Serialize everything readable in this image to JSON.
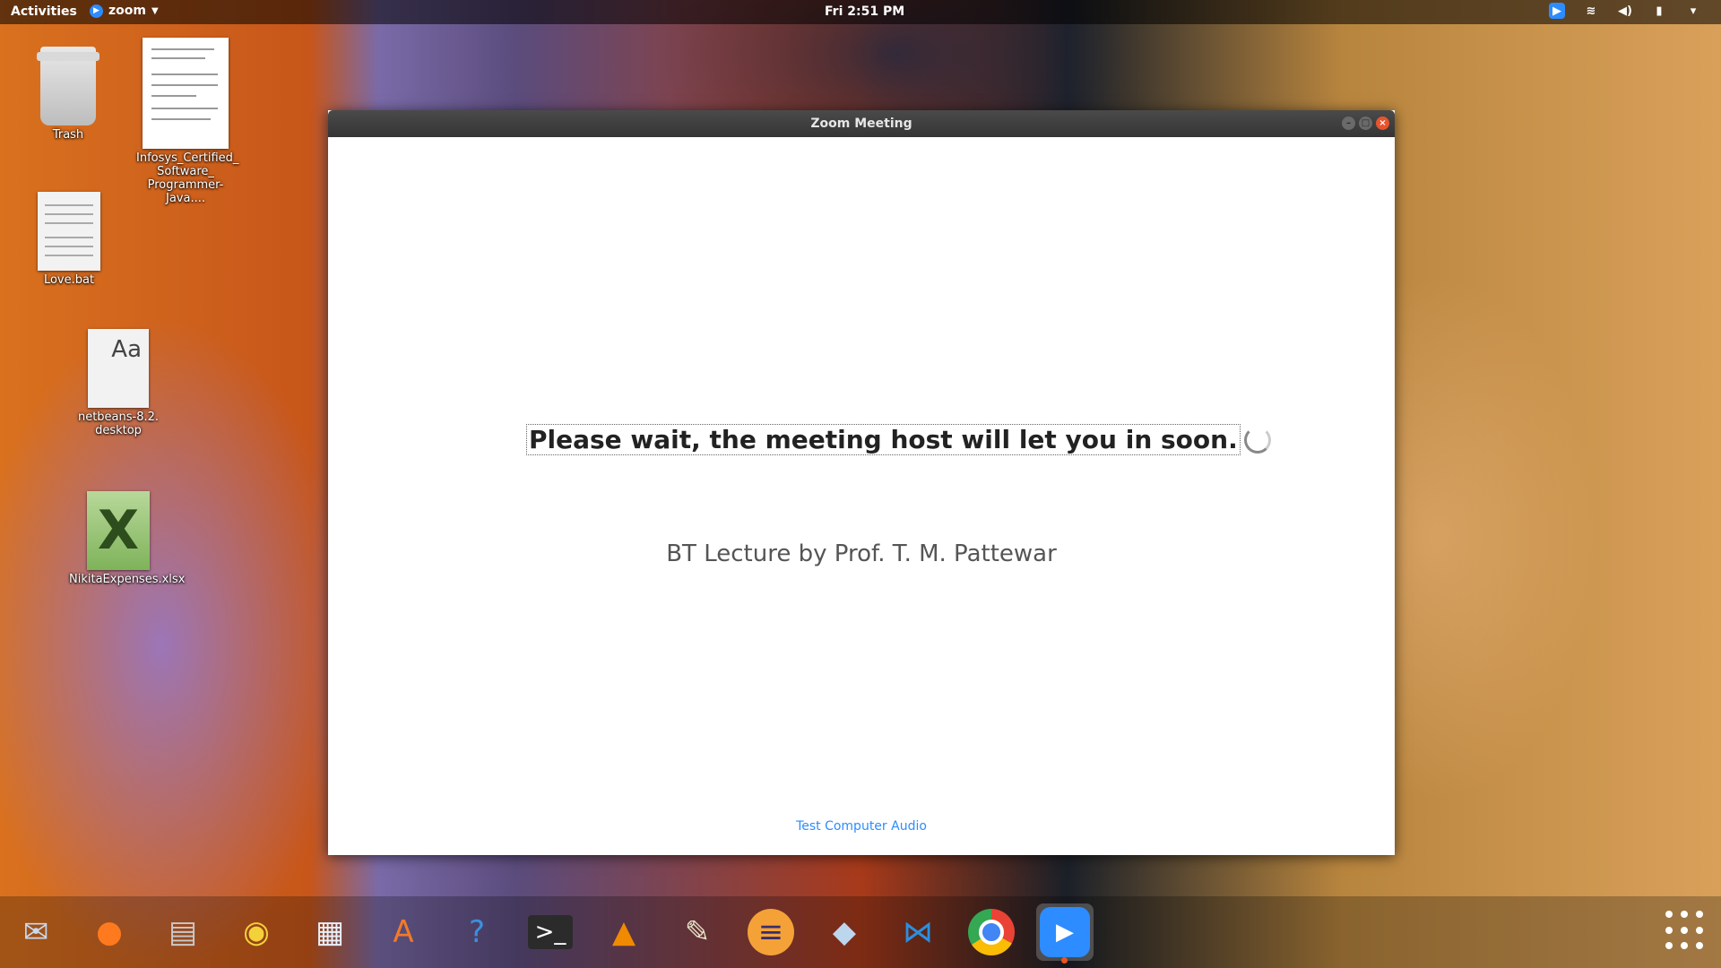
{
  "topbar": {
    "activities": "Activities",
    "app_name": "zoom",
    "clock": "Fri  2:51 PM",
    "tray_icons": [
      "zoom-tray-icon",
      "wifi-icon",
      "volume-icon",
      "battery-icon",
      "power-menu-icon"
    ]
  },
  "desktop": {
    "icons": [
      {
        "label": "Trash",
        "icon": "trash-icon"
      },
      {
        "label": "Infosys_Certified_ Software_ Programmer-Java....",
        "icon": "document-icon"
      },
      {
        "label": "Love.bat",
        "icon": "text-file-icon"
      },
      {
        "label": "netbeans-8.2. desktop",
        "icon": "font-file-icon"
      },
      {
        "label": "NikitaExpenses.xlsx",
        "icon": "spreadsheet-icon"
      }
    ]
  },
  "zoom_window": {
    "title": "Zoom Meeting",
    "wait_message": "Please wait, the meeting host will let you in soon.",
    "meeting_name": "BT Lecture by Prof. T. M. Pattewar",
    "test_audio": "Test Computer Audio"
  },
  "dock": {
    "apps": [
      "thunderbird",
      "firefox",
      "files",
      "rhythmbox",
      "libreoffice-writer",
      "ubuntu-software",
      "help",
      "terminal",
      "vlc",
      "text-editor",
      "eclipse",
      "virtualbox",
      "vscode",
      "chrome",
      "zoom"
    ],
    "active_app": "zoom",
    "accent_color": "#e95420"
  },
  "colors": {
    "zoom_blue": "#2d8cff",
    "titlebar": "#3c3c3c",
    "close_button": "#e9542d"
  }
}
